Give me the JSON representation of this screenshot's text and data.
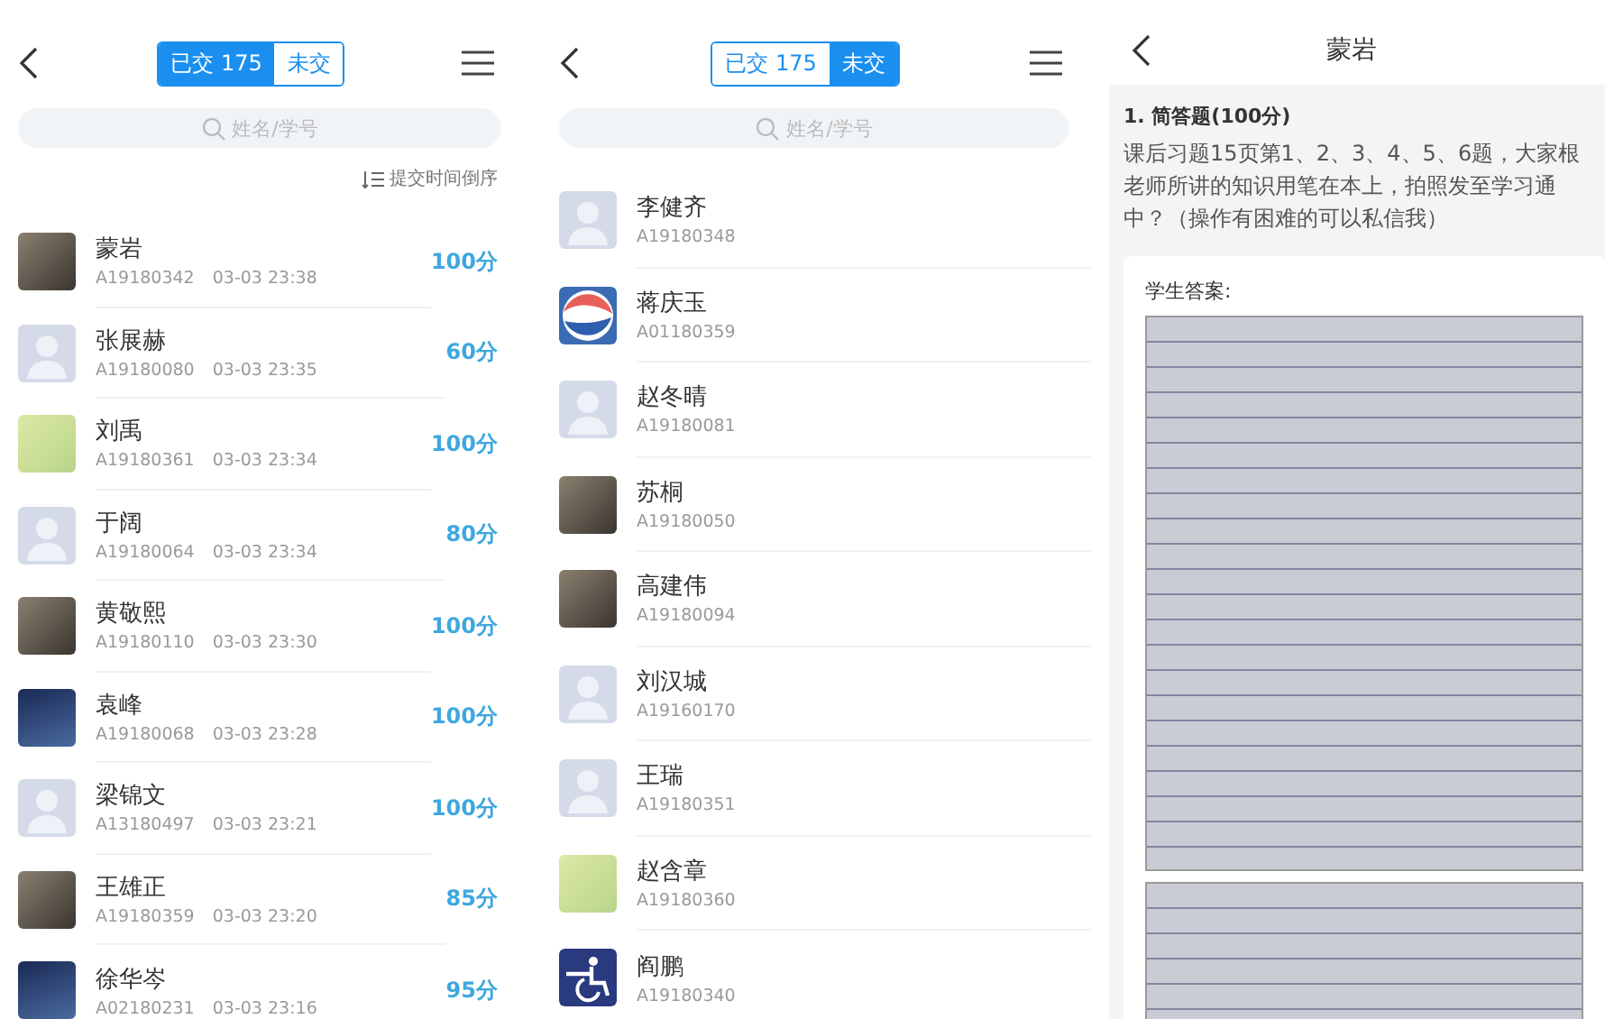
{
  "screens": [
    {
      "kind": "list",
      "segments": [
        {
          "label": "已交 175",
          "selected": true
        },
        {
          "label": "未交",
          "selected": false
        }
      ],
      "search": {
        "placeholder": "姓名/学号"
      },
      "sort_label": "提交时间倒序",
      "students": [
        {
          "name": "蒙岩",
          "id": "A19180342",
          "time": "03-03 23:38",
          "score": "100分",
          "kind": "photo"
        },
        {
          "name": "张展赫",
          "id": "A19180080",
          "time": "03-03 23:35",
          "score": "60分",
          "kind": "default"
        },
        {
          "name": "刘禹",
          "id": "A19180361",
          "time": "03-03 23:34",
          "score": "100分",
          "kind": "cartoon"
        },
        {
          "name": "于阔",
          "id": "A19180064",
          "time": "03-03 23:34",
          "score": "80分",
          "kind": "default"
        },
        {
          "name": "黄敬熙",
          "id": "A19180110",
          "time": "03-03 23:30",
          "score": "100分",
          "kind": "photo"
        },
        {
          "name": "袁峰",
          "id": "A19180068",
          "time": "03-03 23:28",
          "score": "100分",
          "kind": "night"
        },
        {
          "name": "梁锦文",
          "id": "A13180497",
          "time": "03-03 23:21",
          "score": "100分",
          "kind": "default"
        },
        {
          "name": "王雄正",
          "id": "A19180359",
          "time": "03-03 23:20",
          "score": "85分",
          "kind": "photo"
        },
        {
          "name": "徐华岑",
          "id": "A02180231",
          "time": "03-03 23:16",
          "score": "95分",
          "kind": "night"
        }
      ]
    },
    {
      "kind": "list",
      "segments": [
        {
          "label": "已交 175",
          "selected": false
        },
        {
          "label": "未交",
          "selected": true
        }
      ],
      "search": {
        "placeholder": "姓名/学号"
      },
      "students": [
        {
          "name": "李健齐",
          "id": "A19180348",
          "kind": "default"
        },
        {
          "name": "蒋庆玉",
          "id": "A01180359",
          "kind": "logo"
        },
        {
          "name": "赵冬晴",
          "id": "A19180081",
          "kind": "default"
        },
        {
          "name": "苏桐",
          "id": "A19180050",
          "kind": "photo"
        },
        {
          "name": "高建伟",
          "id": "A19180094",
          "kind": "photo"
        },
        {
          "name": "刘汉城",
          "id": "A19160170",
          "kind": "default"
        },
        {
          "name": "王瑞",
          "id": "A19180351",
          "kind": "default"
        },
        {
          "name": "赵含章",
          "id": "A19180360",
          "kind": "cartoon"
        },
        {
          "name": "阎鹏",
          "id": "A19180340",
          "kind": "wheelchair"
        }
      ]
    },
    {
      "kind": "answer",
      "title": "蒙岩",
      "question_title": "1. 简答题(100分)",
      "question_lines": [
        "课后习题15页第1、2、3、4、5、6题，大家根",
        "老师所讲的知识用笔在本上，拍照发至学习通",
        "中？（操作有困难的可以私信我）"
      ],
      "answer_label": "学生答案:"
    }
  ]
}
